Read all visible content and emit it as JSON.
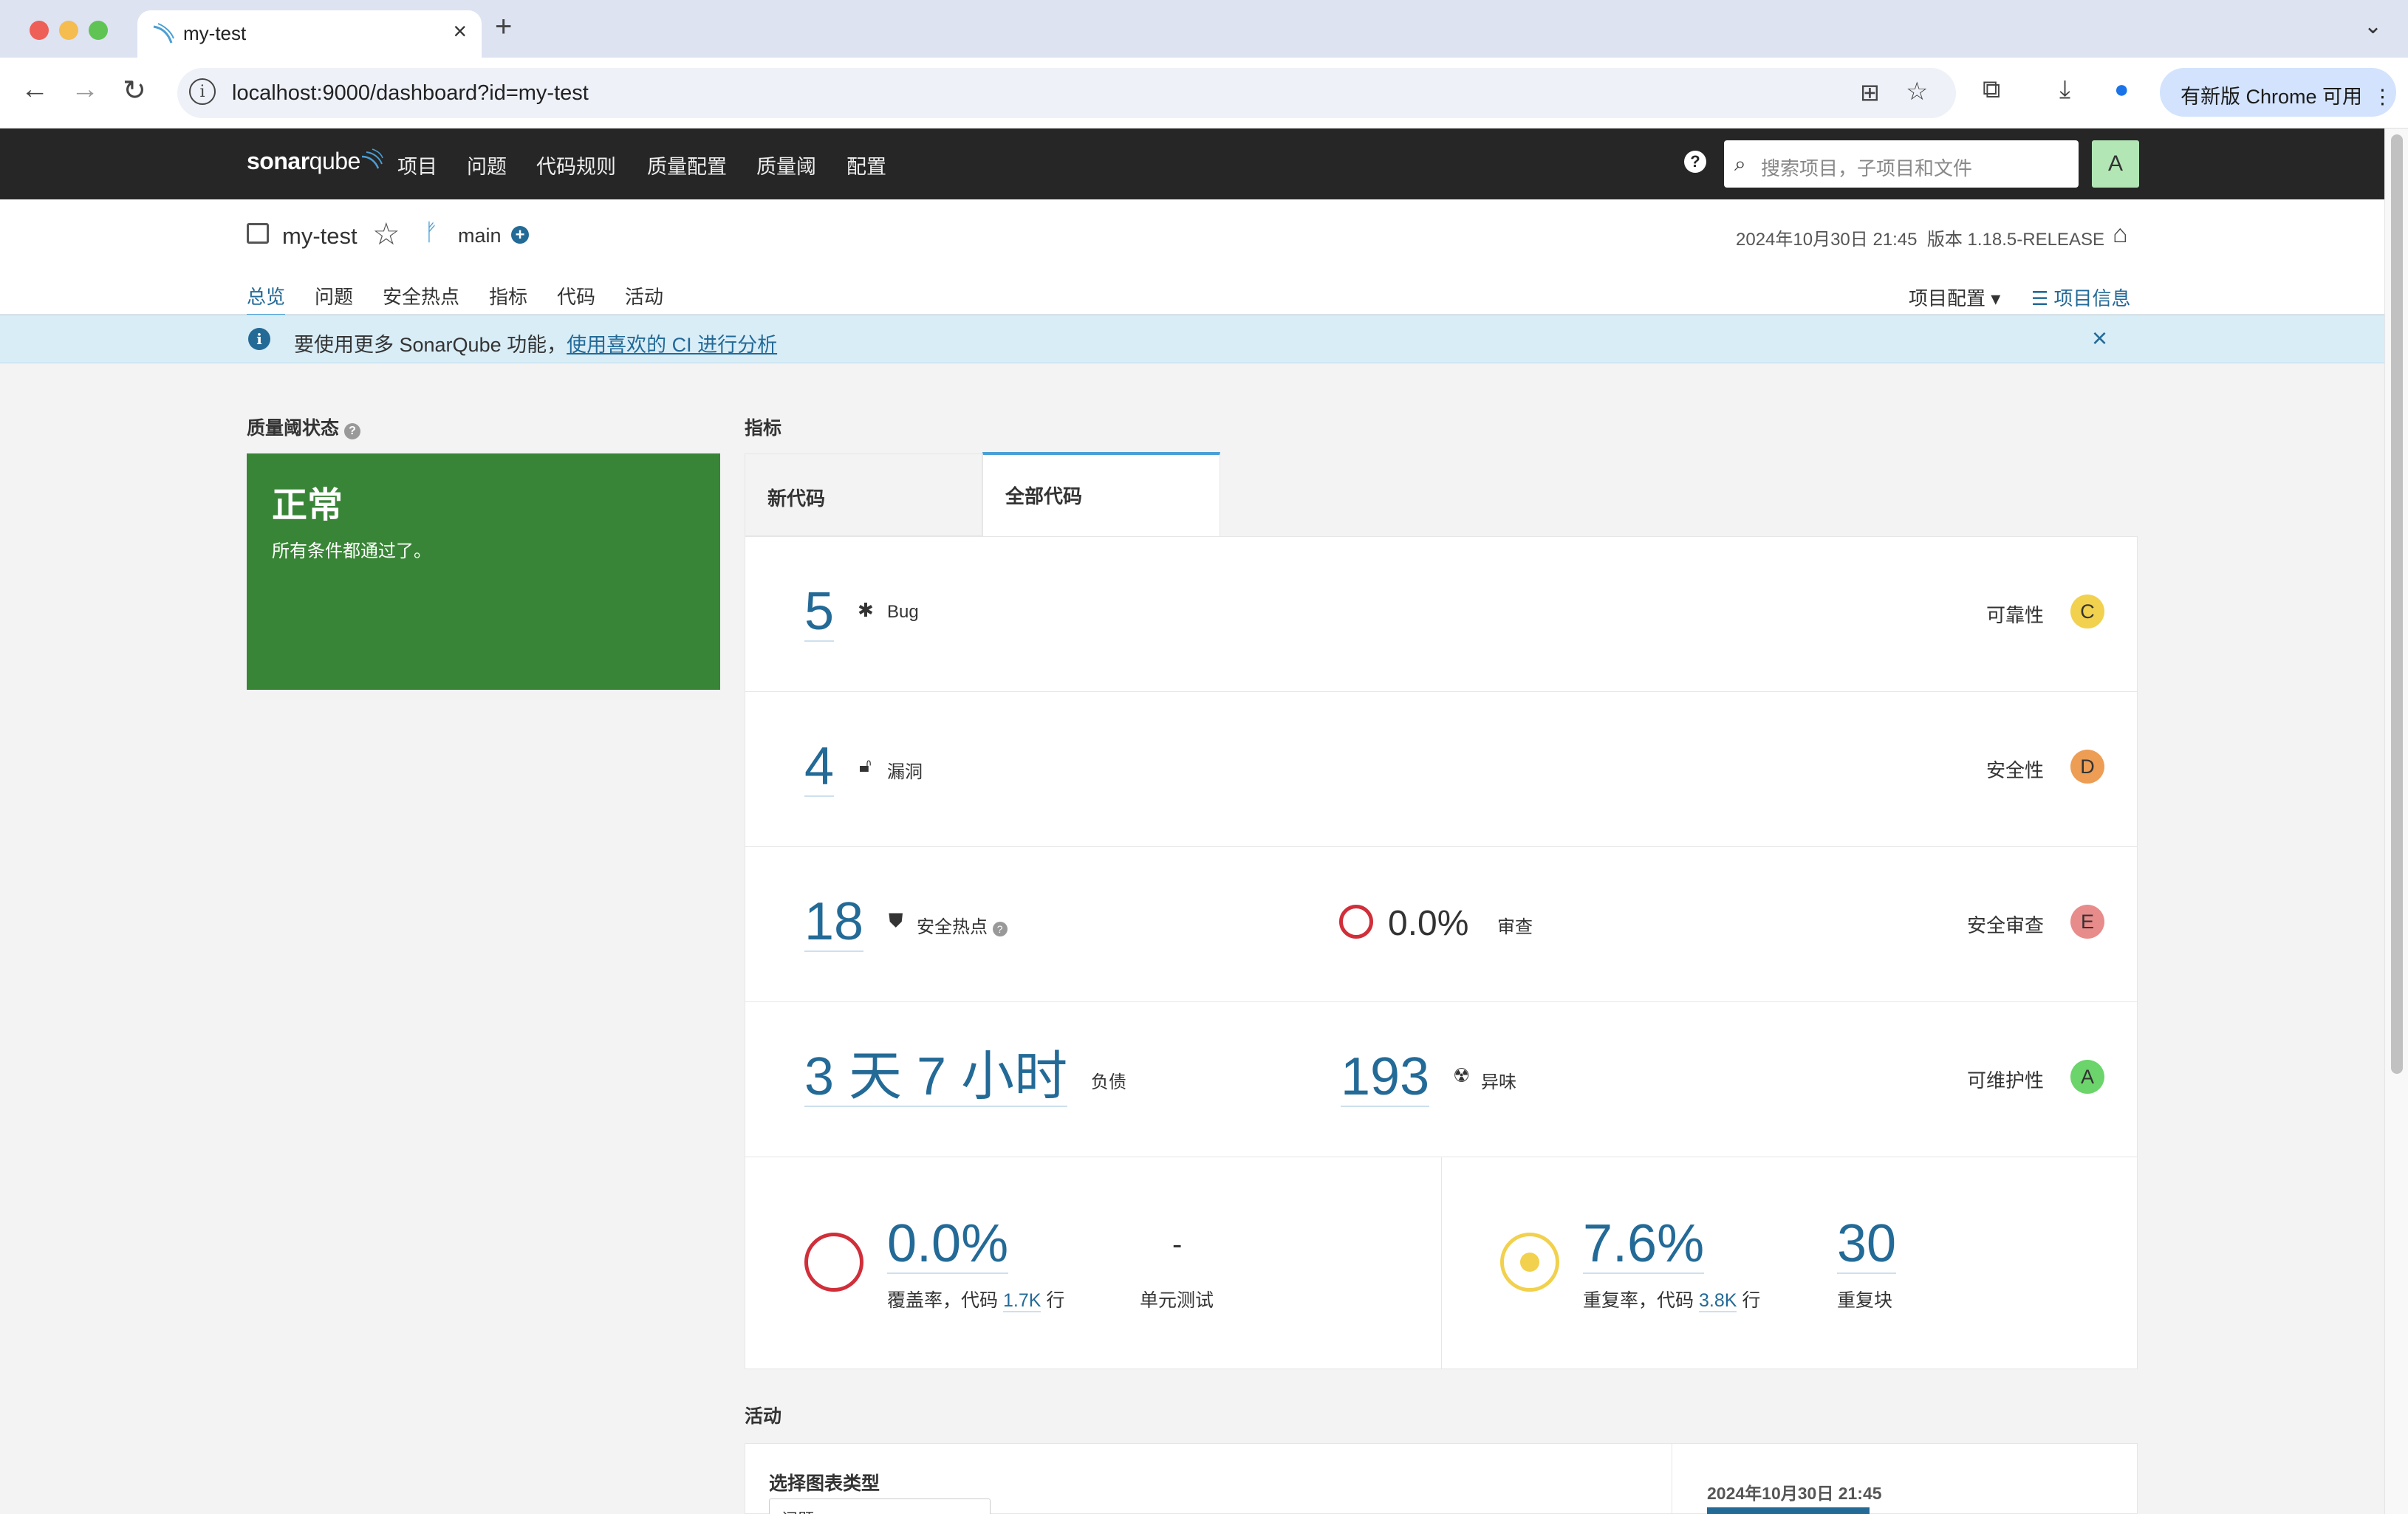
{
  "browser": {
    "tab_title": "my-test",
    "url": "localhost:9000/dashboard?id=my-test",
    "update_label": "有新版 Chrome 可用"
  },
  "nav": {
    "logo_bold": "sonar",
    "logo_rest": "qube",
    "items": [
      "项目",
      "问题",
      "代码规则",
      "质量配置",
      "质量阈",
      "配置"
    ],
    "search_placeholder": "搜索项目，子项目和文件",
    "avatar": "A",
    "help": "?"
  },
  "project": {
    "name": "my-test",
    "branch": "main",
    "analysis_date": "2024年10月30日 21:45",
    "version": "版本 1.18.5-RELEASE",
    "tabs": [
      "总览",
      "问题",
      "安全热点",
      "指标",
      "代码",
      "活动"
    ],
    "project_config": "项目配置 ▾",
    "project_info": "项目信息"
  },
  "banner": {
    "text": "要使用更多 SonarQube 功能，",
    "link": "使用喜欢的 CI 进行分析"
  },
  "quality_gate": {
    "title": "质量阈状态",
    "status": "正常",
    "detail": "所有条件都通过了。",
    "status_color": "#398537"
  },
  "metrics": {
    "title": "指标",
    "tab_new": "新代码",
    "tab_all": "全部代码",
    "bugs": {
      "value": "5",
      "label": "Bug",
      "rating_label": "可靠性",
      "rating": "C",
      "rating_color": "#f1d14d"
    },
    "vulns": {
      "value": "4",
      "label": "漏洞",
      "rating_label": "安全性",
      "rating": "D",
      "rating_color": "#ed9d54"
    },
    "hotspots": {
      "value": "18",
      "label": "安全热点",
      "reviewed": "0.0%",
      "reviewed_label": "审查",
      "rating_label": "安全审查",
      "rating": "E",
      "rating_color": "#e88b8b"
    },
    "debt": {
      "value": "3 天 7 小时",
      "label": "负债",
      "smells": "193",
      "smells_label": "异味",
      "rating_label": "可维护性",
      "rating": "A",
      "rating_color": "#6bd46b"
    },
    "coverage": {
      "value": "0.0%",
      "label_pre": "覆盖率，代码",
      "lines": "1.7K",
      "label_post": "行",
      "unit_tests": "-",
      "unit_tests_label": "单元测试"
    },
    "duplication": {
      "value": "7.6%",
      "label_pre": "重复率，代码",
      "lines": "3.8K",
      "label_post": "行",
      "blocks": "30",
      "blocks_label": "重复块"
    }
  },
  "activity": {
    "title": "活动",
    "chart_type_label": "选择图表类型",
    "chart_type_value": "问题",
    "date": "2024年10月30日 21:45"
  }
}
